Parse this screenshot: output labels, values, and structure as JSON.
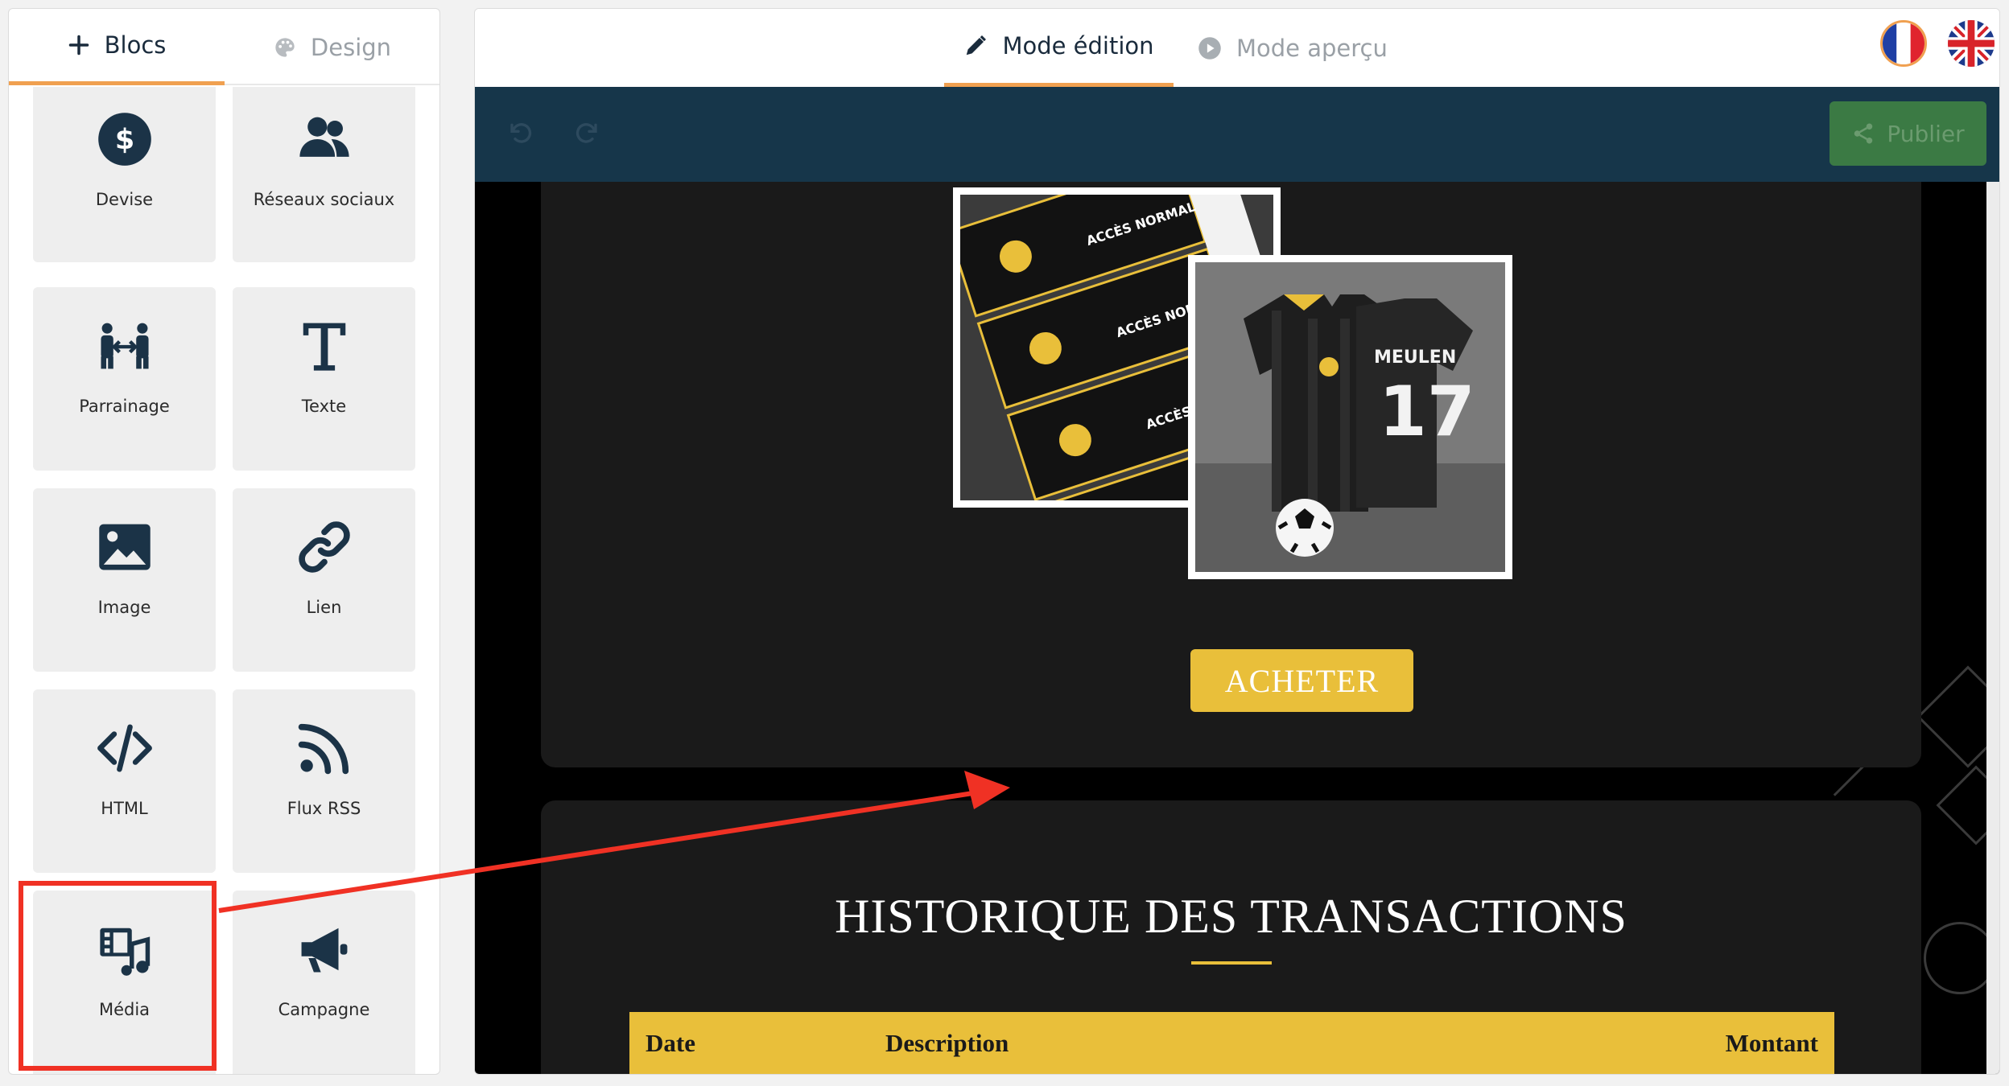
{
  "left_tabs": {
    "blocks": "Blocs",
    "design": "Design"
  },
  "blocks": [
    {
      "label": "Devise",
      "icon": "dollar-circle-icon"
    },
    {
      "label": "Réseaux sociaux",
      "icon": "users-icon"
    },
    {
      "label": "Parrainage",
      "icon": "referral-icon"
    },
    {
      "label": "Texte",
      "icon": "text-icon"
    },
    {
      "label": "Image",
      "icon": "image-icon"
    },
    {
      "label": "Lien",
      "icon": "link-icon"
    },
    {
      "label": "HTML",
      "icon": "code-icon"
    },
    {
      "label": "Flux RSS",
      "icon": "rss-icon"
    },
    {
      "label": "Média",
      "icon": "media-icon"
    },
    {
      "label": "Campagne",
      "icon": "megaphone-icon"
    }
  ],
  "editor_tabs": {
    "edit": "Mode édition",
    "preview": "Mode aperçu"
  },
  "toolbar": {
    "publish": "Publier"
  },
  "page": {
    "buy_button": "ACHETER",
    "transactions_title": "HISTORIQUE DES TRANSACTIONS",
    "table_headers": {
      "date": "Date",
      "description": "Description",
      "amount": "Montant"
    },
    "jersey_text": "MEULEN",
    "jersey_number": "17",
    "ticket_text": "ACCÈS NORMAL"
  },
  "colors": {
    "accent_orange": "#f0a050",
    "navy": "#16364a",
    "gold": "#e9bf3a",
    "highlight_red": "#f03124",
    "publish_green": "#3b7a44"
  }
}
